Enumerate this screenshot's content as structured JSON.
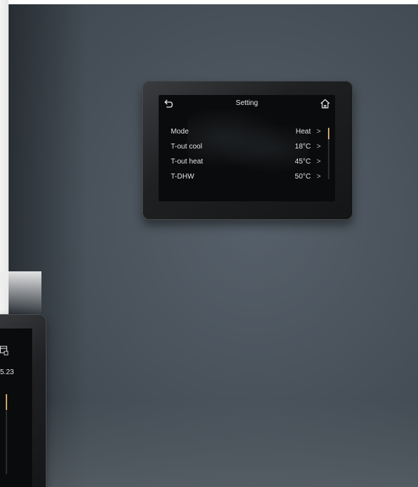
{
  "device": {
    "title": "Setting",
    "back_icon": "back-arrow-icon",
    "home_icon": "home-icon",
    "items": [
      {
        "label": "Mode",
        "value": "Heat"
      },
      {
        "label": "T-out cool",
        "value": "18°C"
      },
      {
        "label": "T-out heat",
        "value": "45°C"
      },
      {
        "label": "T-DHW",
        "value": "50°C"
      }
    ],
    "chevron": ">",
    "accent_color": "#c8a46a"
  },
  "device2": {
    "value": "5.23",
    "icon": "calendar-delete-icon"
  }
}
